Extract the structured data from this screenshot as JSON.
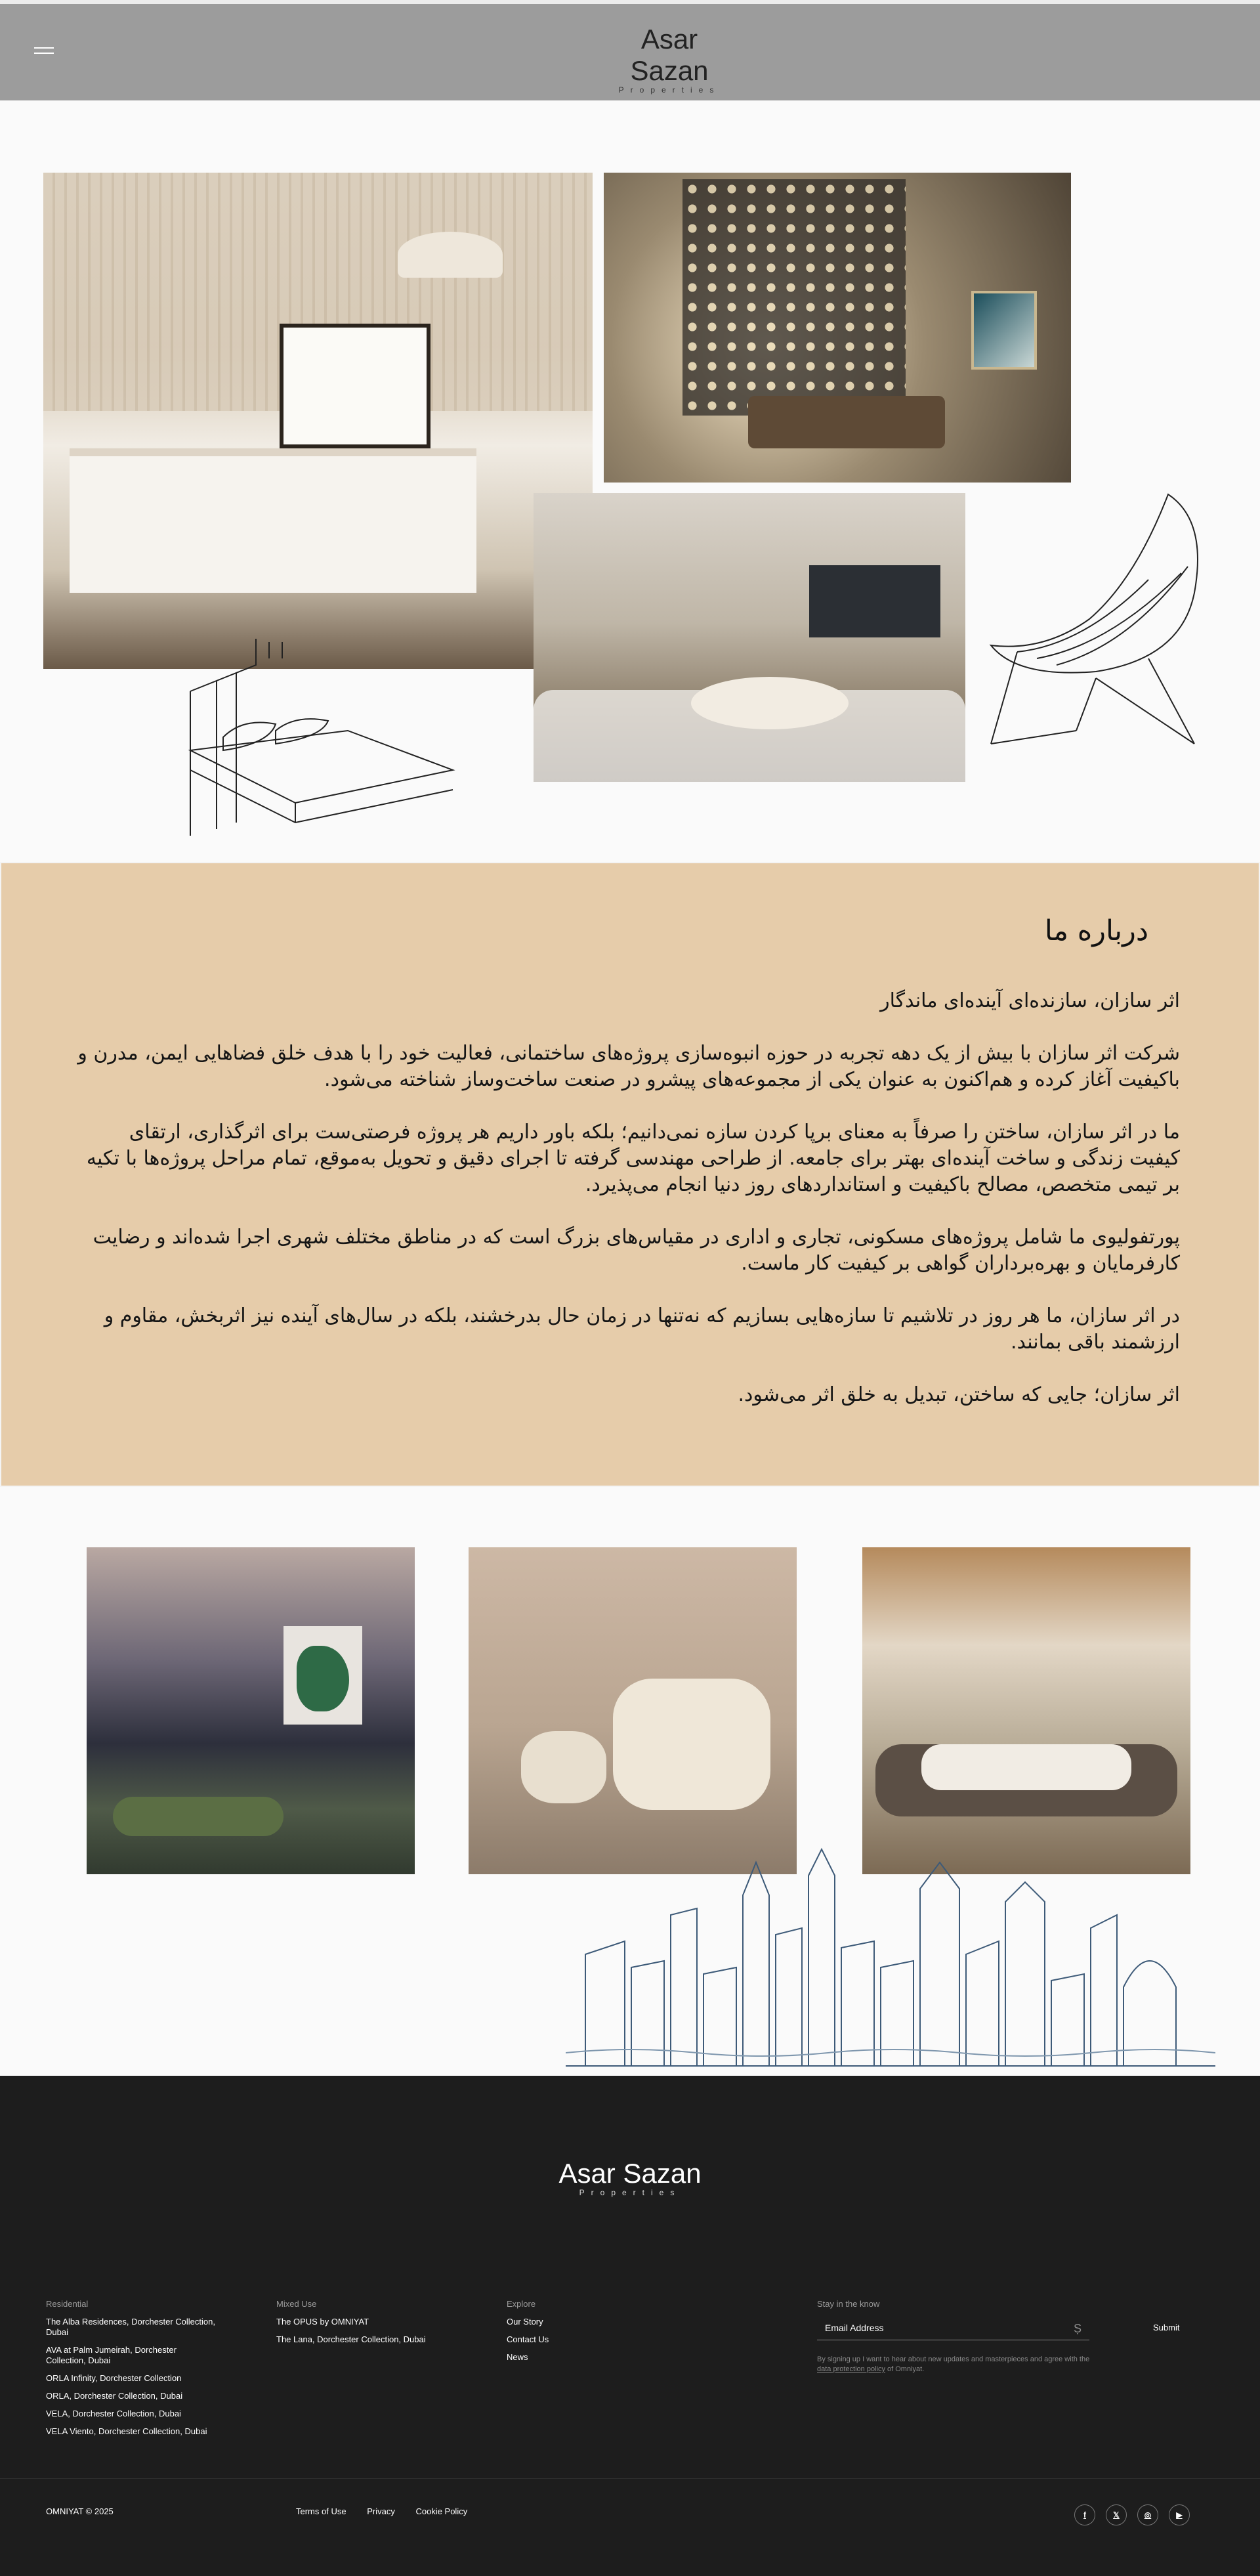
{
  "brand": {
    "name": "Asar Sazan",
    "tagline": "Properties"
  },
  "about": {
    "title": "درباره ما",
    "paragraphs": [
      "اثر سازان، سازنده‌ای آینده‌ای ماندگار",
      "شرکت اثر سازان با بیش از یک دهه تجربه در حوزه انبوه‌سازی پروژه‌های ساختمانی، فعالیت خود را با هدف خلق فضاهایی ایمن، مدرن و باکیفیت آغاز کرده و هم‌اکنون به عنوان یکی از مجموعه‌های پیشرو در صنعت ساخت‌وساز شناخته می‌شود.",
      "ما در اثر سازان، ساختن را صرفاً به معنای برپا کردن سازه نمی‌دانیم؛ بلکه باور داریم هر پروژه فرصتی‌ست برای اثرگذاری، ارتقای کیفیت زندگی و ساخت آینده‌ای بهتر برای جامعه. از طراحی مهندسی گرفته تا اجرای دقیق و تحویل به‌موقع، تمام مراحل پروژه‌ها با تکیه بر تیمی متخصص، مصالح باکیفیت و استانداردهای روز دنیا انجام می‌پذیرد.",
      "پورتفولیوی ما شامل پروژه‌های مسکونی، تجاری و اداری در مقیاس‌های بزرگ است که در مناطق مختلف شهری اجرا شده‌اند و رضایت کارفرمایان و بهره‌برداران گواهی بر کیفیت کار ماست.",
      "در اثر سازان، ما هر روز در تلاشیم تا سازه‌هایی بسازیم که نه‌تنها در زمان حال بدرخشند، بلکه در سال‌های آینده نیز اثربخش، مقاوم و ارزشمند باقی بمانند.",
      "اثر سازان؛ جایی که ساختن، تبدیل به خلق اثر می‌شود."
    ]
  },
  "footer": {
    "columns": [
      {
        "heading": "Residential",
        "links": [
          "The Alba Residences, Dorchester Collection, Dubai",
          "AVA at Palm Jumeirah, Dorchester Collection, Dubai",
          "ORLA Infinity, Dorchester Collection",
          "ORLA, Dorchester Collection, Dubai",
          "VELA, Dorchester Collection, Dubai",
          "VELA Viento, Dorchester Collection, Dubai"
        ]
      },
      {
        "heading": "Mixed Use",
        "links": [
          "The OPUS by OMNIYAT",
          "The Lana, Dorchester Collection, Dubai"
        ]
      },
      {
        "heading": "Explore",
        "links": [
          "Our Story",
          "Contact Us",
          "News"
        ]
      }
    ],
    "newsletter": {
      "heading": "Stay in the know",
      "placeholder": "Email Address",
      "submit": "Submit",
      "legal_prefix": "By signing up I want to hear about new updates and masterpieces and agree with the ",
      "legal_link": "data protection policy",
      "legal_suffix": " of Omniyat."
    },
    "copyright": "OMNIYAT © 2025",
    "legal_links": [
      "Terms of Use",
      "Privacy",
      "Cookie Policy"
    ],
    "social": [
      {
        "icon": "facebook-icon",
        "glyph": "f"
      },
      {
        "icon": "x-icon",
        "glyph": "𝕏"
      },
      {
        "icon": "instagram-icon",
        "glyph": "◎"
      },
      {
        "icon": "youtube-icon",
        "glyph": "▶"
      }
    ]
  }
}
